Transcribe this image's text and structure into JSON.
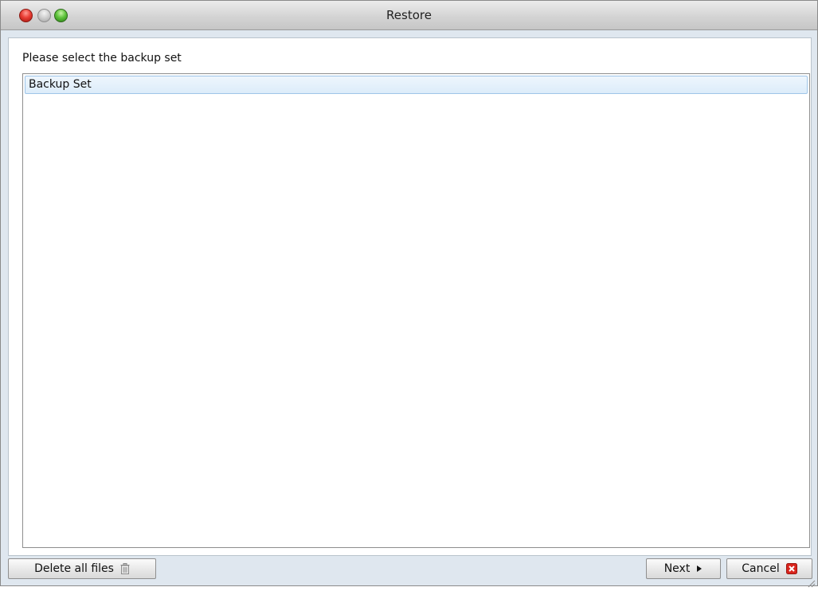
{
  "window": {
    "title": "Restore"
  },
  "main": {
    "prompt": "Please select the backup set",
    "list": {
      "items": [
        {
          "label": "Backup Set",
          "selected": true
        }
      ]
    }
  },
  "footer": {
    "delete_label": "Delete all files",
    "next_label": "Next",
    "cancel_label": "Cancel"
  },
  "icons": {
    "delete": "trash-icon",
    "next": "triangle-right-icon",
    "cancel": "close-x-icon"
  },
  "colors": {
    "window_background": "#dfe7ef",
    "selection_border": "#9fc5e8",
    "selection_fill": "#dcecfa",
    "cancel_icon": "#d9241c"
  }
}
